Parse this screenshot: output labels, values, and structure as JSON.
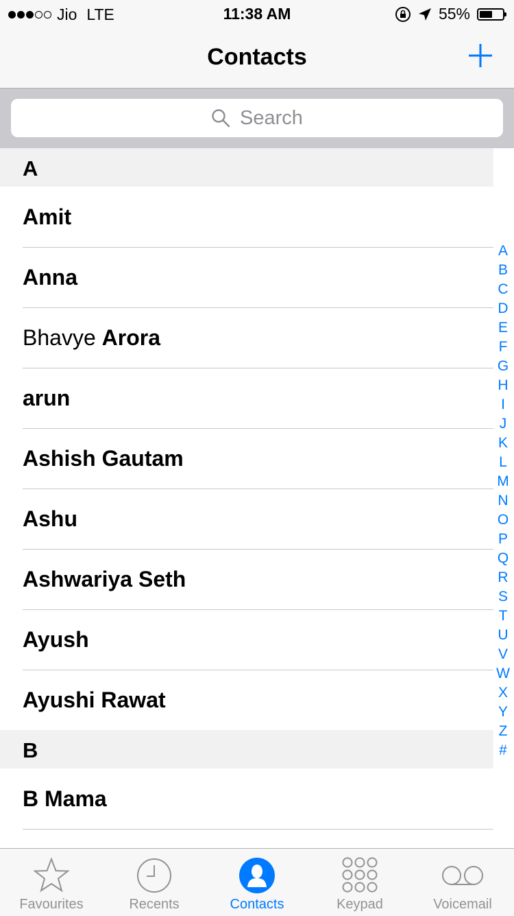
{
  "status_bar": {
    "carrier": "Jio",
    "network": "LTE",
    "time": "11:38 AM",
    "battery": "55%",
    "battery_level": 0.55,
    "signal_bars_filled": 3,
    "signal_bars_total": 5,
    "icons": [
      "rotation-lock-icon",
      "location-arrow-icon",
      "battery-icon"
    ]
  },
  "nav": {
    "title": "Contacts",
    "add_icon": "plus-icon",
    "accent_color": "#007aff"
  },
  "search": {
    "placeholder": "Search",
    "icon": "search-icon"
  },
  "sections": [
    {
      "letter": "A",
      "contacts": [
        {
          "first": "",
          "last": "Amit"
        },
        {
          "first": "",
          "last": "Anna"
        },
        {
          "first": "Bhavye",
          "last": "Arora"
        },
        {
          "first": "",
          "last": "arun"
        },
        {
          "first": "",
          "last": "Ashish Gautam"
        },
        {
          "first": "",
          "last": "Ashu"
        },
        {
          "first": "",
          "last": "Ashwariya Seth"
        },
        {
          "first": "",
          "last": "Ayush"
        },
        {
          "first": "",
          "last": "Ayushi Rawat"
        }
      ]
    },
    {
      "letter": "B",
      "contacts": [
        {
          "first": "",
          "last": "B Mama"
        }
      ]
    }
  ],
  "index_letters": [
    "A",
    "B",
    "C",
    "D",
    "E",
    "F",
    "G",
    "H",
    "I",
    "J",
    "K",
    "L",
    "M",
    "N",
    "O",
    "P",
    "Q",
    "R",
    "S",
    "T",
    "U",
    "V",
    "W",
    "X",
    "Y",
    "Z",
    "#"
  ],
  "tabs": [
    {
      "label": "Favourites",
      "icon": "star-icon",
      "active": false
    },
    {
      "label": "Recents",
      "icon": "clock-icon",
      "active": false
    },
    {
      "label": "Contacts",
      "icon": "person-circle-icon",
      "active": true
    },
    {
      "label": "Keypad",
      "icon": "keypad-icon",
      "active": false
    },
    {
      "label": "Voicemail",
      "icon": "voicemail-icon",
      "active": false
    }
  ]
}
